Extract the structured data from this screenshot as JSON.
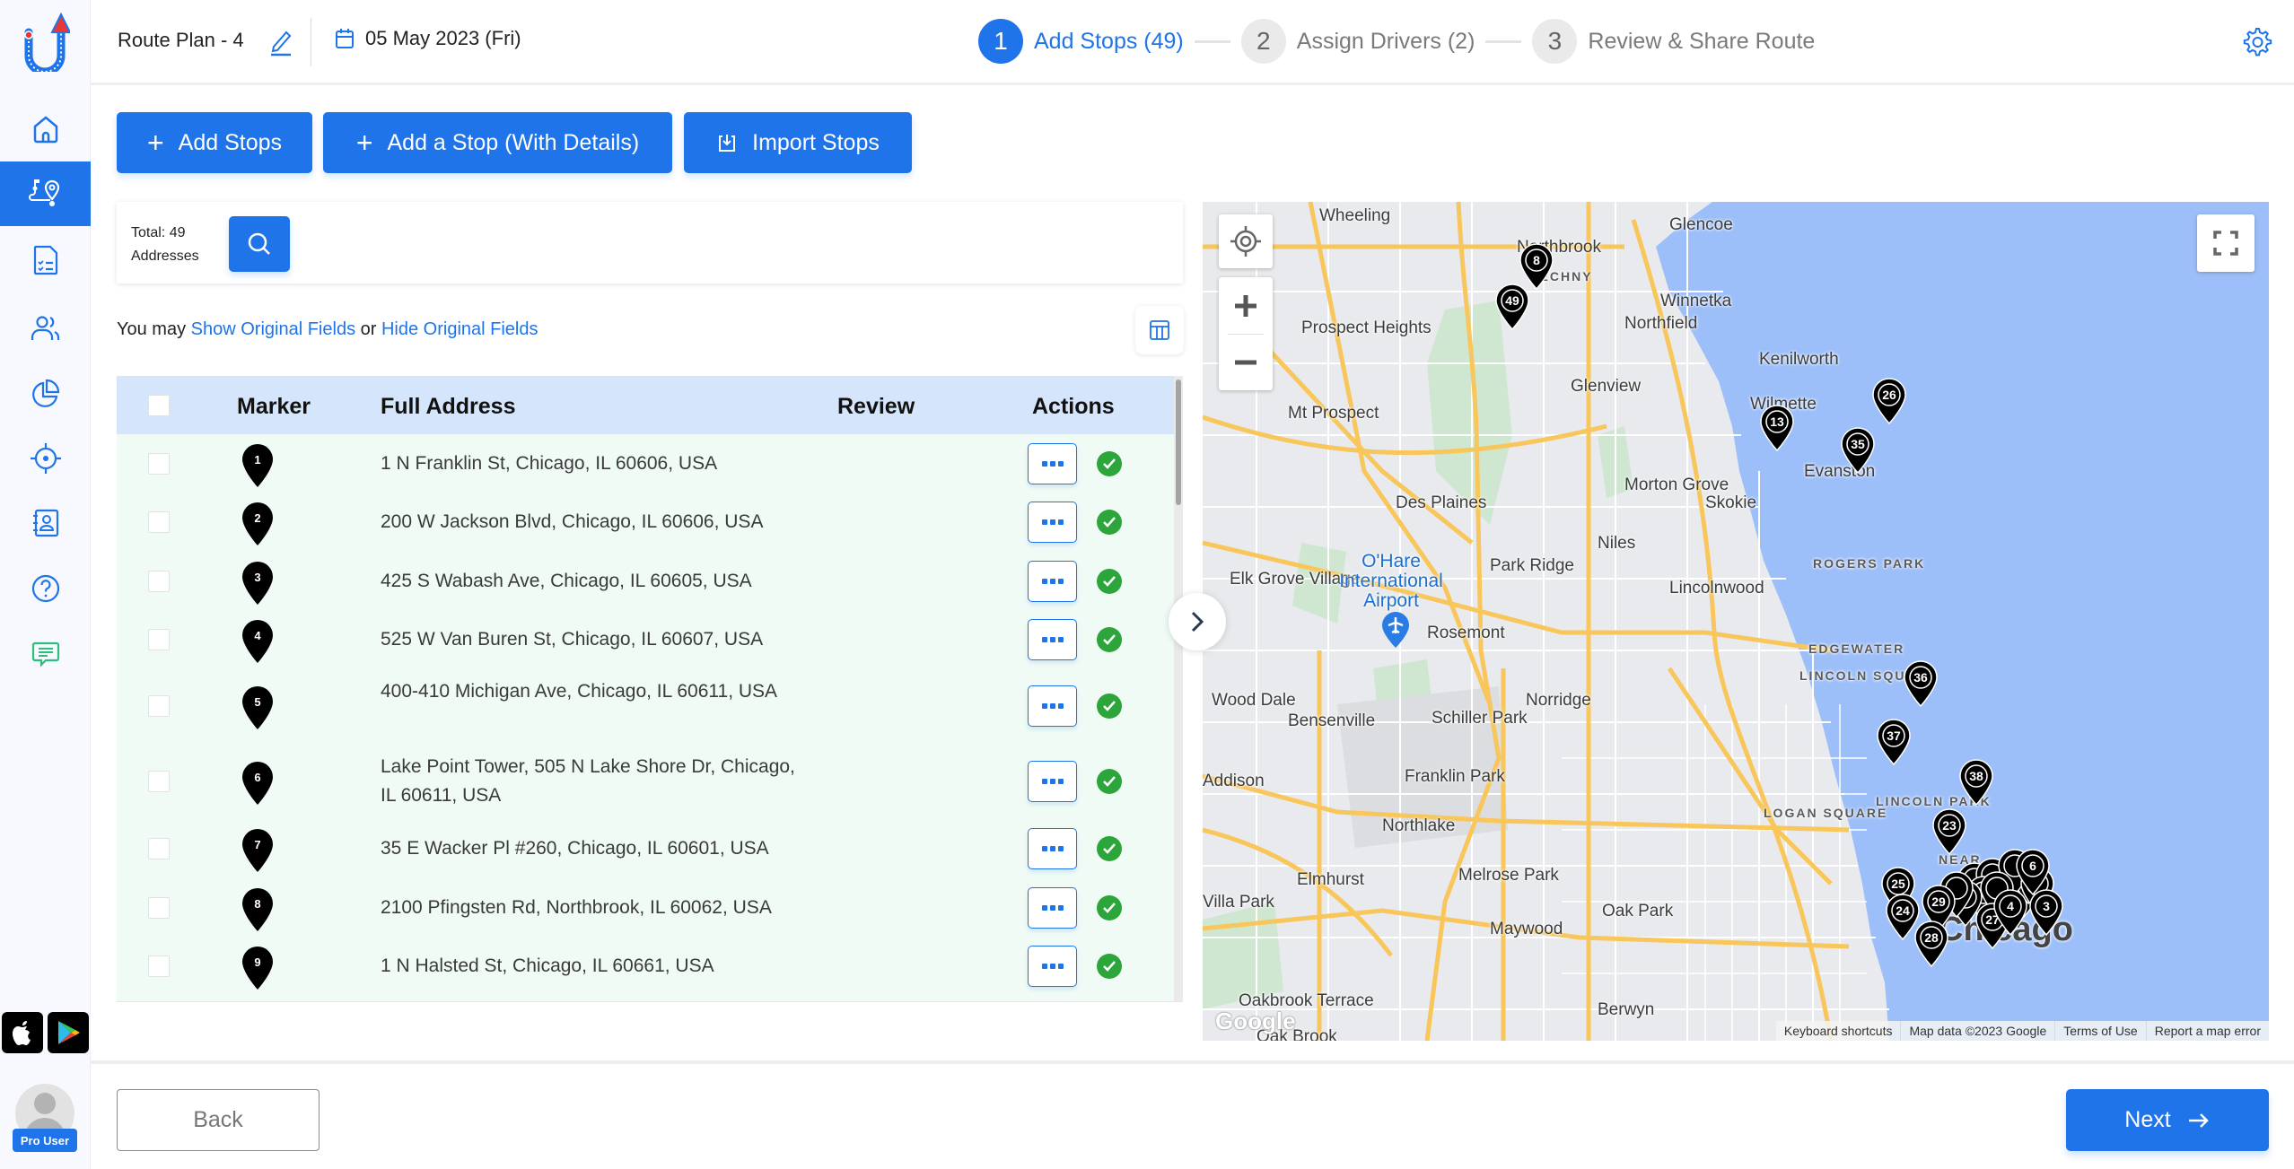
{
  "header": {
    "plan_title": "Route Plan - 4",
    "date": "05 May 2023 (Fri)",
    "steps": [
      {
        "num": "1",
        "label": "Add Stops (49)",
        "active": true
      },
      {
        "num": "2",
        "label": "Assign Drivers (2)",
        "active": false
      },
      {
        "num": "3",
        "label": "Review & Share Route",
        "active": false
      }
    ]
  },
  "sidebar": {
    "items": [
      {
        "name": "home",
        "active": false
      },
      {
        "name": "route-planner",
        "active": true
      },
      {
        "name": "reports",
        "active": false
      },
      {
        "name": "drivers",
        "active": false
      },
      {
        "name": "analytics",
        "active": false
      },
      {
        "name": "live-tracking",
        "active": false
      },
      {
        "name": "contacts",
        "active": false
      },
      {
        "name": "help",
        "active": false
      },
      {
        "name": "chat",
        "active": false
      }
    ],
    "user_badge": "Pro User"
  },
  "toolbar": {
    "add_stops": "Add Stops",
    "add_stop_details": "Add a Stop (With Details)",
    "import_stops": "Import Stops"
  },
  "summary": {
    "total_line1": "Total: 49",
    "total_line2": "Addresses"
  },
  "fields": {
    "prefix": "You may ",
    "show_link": "Show Original Fields",
    "middle": " or ",
    "hide_link": "Hide Original Fields"
  },
  "table": {
    "columns": {
      "marker": "Marker",
      "address": "Full Address",
      "review": "Review",
      "actions": "Actions"
    },
    "rows": [
      {
        "marker": "1",
        "address": "1 N Franklin St, Chicago, IL 60606, USA",
        "status": "verified"
      },
      {
        "marker": "2",
        "address": "200 W Jackson Blvd, Chicago, IL 60606, USA",
        "status": "verified"
      },
      {
        "marker": "3",
        "address": "425 S Wabash Ave, Chicago, IL 60605, USA",
        "status": "verified"
      },
      {
        "marker": "4",
        "address": "525 W Van Buren St, Chicago, IL 60607, USA",
        "status": "verified"
      },
      {
        "marker": "5",
        "address": "400-410 Michigan Ave, Chicago, IL 60611, USA",
        "status": "verified"
      },
      {
        "marker": "6",
        "address": "Lake Point Tower, 505 N Lake Shore Dr, Chicago, IL 60611, USA",
        "status": "verified"
      },
      {
        "marker": "7",
        "address": "35 E Wacker Pl #260, Chicago, IL 60601, USA",
        "status": "verified"
      },
      {
        "marker": "8",
        "address": "2100 Pfingsten Rd, Northbrook, IL 60062, USA",
        "status": "verified"
      },
      {
        "marker": "9",
        "address": "1 N Halsted St, Chicago, IL 60661, USA",
        "status": "verified"
      }
    ]
  },
  "map": {
    "labels": {
      "wheeling": "Wheeling",
      "northbrook": "Northbrook",
      "techny": "TECHNY",
      "glencoe": "Glencoe",
      "winnetka": "Winnetka",
      "northfield": "Northfield",
      "prospect_heights": "Prospect Heights",
      "kenilworth": "Kenilworth",
      "glenview": "Glenview",
      "wilmette": "Wilmette",
      "mt_prospect": "Mt Prospect",
      "evanston": "Evanston",
      "morton_grove": "Morton Grove",
      "des_plaines": "Des Plaines",
      "skokie": "Skokie",
      "niles": "Niles",
      "rogers_park": "ROGERS PARK",
      "park_ridge": "Park Ridge",
      "elk_grove": "Elk Grove Village",
      "ohare": "O'Hare International Airport",
      "lincolnwood": "Lincolnwood",
      "rosemont": "Rosemont",
      "edgewater": "EDGEWATER",
      "lincoln_square": "LINCOLN SQUARE",
      "wood_dale": "Wood Dale",
      "norridge": "Norridge",
      "bensenville": "Bensenville",
      "schiller_park": "Schiller Park",
      "addison": "Addison",
      "franklin_park": "Franklin Park",
      "lincoln_park": "LINCOLN PARK",
      "logan_square": "LOGAN SQUARE",
      "northlake": "Northlake",
      "near_north": "NEAR",
      "elmhurst": "Elmhurst",
      "melrose_park": "Melrose Park",
      "villa_park": "Villa Park",
      "oak_park": "Oak Park",
      "maywood": "Maywood",
      "chicago": "Chicago",
      "oakbrook_terrace": "Oakbrook Terrace",
      "berwyn": "Berwyn",
      "oak_brook": "Oak Brook"
    },
    "markers": [
      {
        "n": "8"
      },
      {
        "n": "49"
      },
      {
        "n": "13"
      },
      {
        "n": "35"
      },
      {
        "n": "26"
      },
      {
        "n": "36"
      },
      {
        "n": "37"
      },
      {
        "n": "38"
      },
      {
        "n": "23"
      },
      {
        "n": "25"
      },
      {
        "n": "24"
      },
      {
        "n": "29"
      },
      {
        "n": "28"
      },
      {
        "n": "27"
      },
      {
        "n": "4"
      },
      {
        "n": "3"
      },
      {
        "n": "6"
      }
    ],
    "attribution": {
      "shortcuts": "Keyboard shortcuts",
      "data": "Map data ©2023 Google",
      "terms": "Terms of Use",
      "report": "Report a map error"
    },
    "google": "Google"
  },
  "footer": {
    "back": "Back",
    "next": "Next"
  },
  "colors": {
    "primary": "#1e74e8",
    "success": "#2ca53a",
    "table_header": "#d4e5fc",
    "table_body": "#f0fbf5",
    "water": "#9dbff9"
  }
}
